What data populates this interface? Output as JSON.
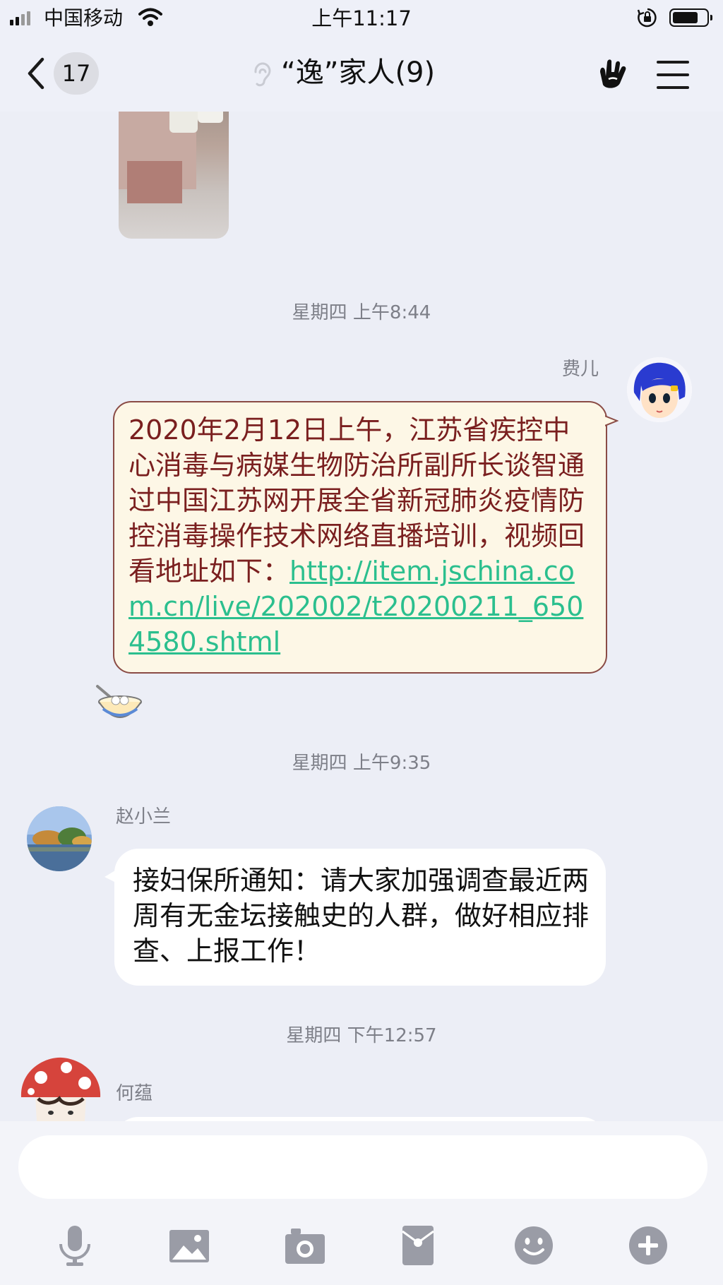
{
  "status_bar": {
    "carrier": "中国移动",
    "time": "上午11:17",
    "battery_level": 0.8
  },
  "nav": {
    "back_badge": "17",
    "title": "“逸”家人(9)"
  },
  "messages": {
    "ts1": "星期四 上午8:44",
    "msg1_sender": "费儿",
    "msg1_text": "2020年2月12日上午，江苏省疾控中心消毒与病媒生物防治所副所长谈智通过中国江苏网开展全省新冠肺炎疫情防控消毒操作技术网络直播培训，视频回看地址如下：",
    "msg1_link": "http://item.jschina.com.cn/live/202002/t20200211_6504580.shtml",
    "ts2": "星期四 上午9:35",
    "msg2_sender": "赵小兰",
    "msg2_text": "接妇保所通知：请大家加强调查最近两周有无金坛接触史的人群，做好相应排查、上报工作！",
    "ts3": "星期四 下午12:57",
    "msg3_sender": "何蕴"
  },
  "input": {
    "placeholder": ""
  },
  "toolbar_icons": [
    "microphone-icon",
    "image-icon",
    "camera-icon",
    "red-packet-icon",
    "emoji-icon",
    "plus-icon"
  ],
  "colors": {
    "background": "#eceef6",
    "bubble_special_bg": "#fdf7e6",
    "bubble_special_text": "#7a1f1f",
    "link": "#2bbf8e",
    "icon_gray": "#9a9ca6"
  }
}
